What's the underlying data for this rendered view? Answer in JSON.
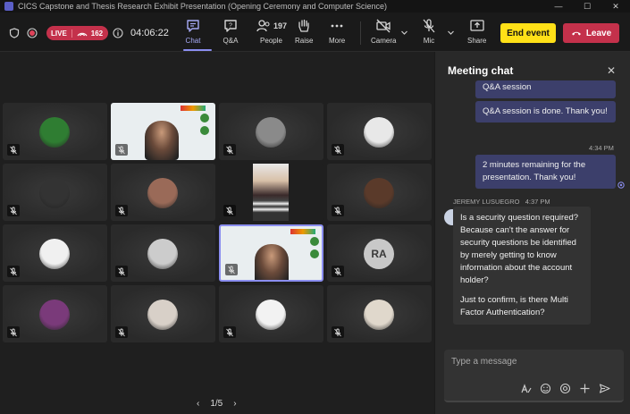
{
  "window": {
    "title": "CICS Capstone and Thesis Research Exhibit Presentation (Opening Ceremony and Computer Science)",
    "controls": [
      "—",
      "☐",
      "✕"
    ]
  },
  "toolbar": {
    "live_label": "LIVE",
    "viewers": "162",
    "timer": "04:06:22",
    "chat_label": "Chat",
    "qa_label": "Q&A",
    "people_label": "People",
    "people_count": "197",
    "raise_label": "Raise",
    "more_label": "More",
    "camera_label": "Camera",
    "mic_label": "Mic",
    "share_label": "Share",
    "end_event_label": "End event",
    "leave_label": "Leave"
  },
  "stage": {
    "tiles": [
      {
        "kind": "avatar",
        "color": "#2f7d32"
      },
      {
        "kind": "slide"
      },
      {
        "kind": "avatar",
        "color": "#8a8a8a"
      },
      {
        "kind": "avatar",
        "color": "#e8e8e8"
      },
      {
        "kind": "avatar",
        "color": "#333333"
      },
      {
        "kind": "avatar",
        "color": "#9a6a58"
      },
      {
        "kind": "portrait"
      },
      {
        "kind": "avatar",
        "color": "#5a3a2a"
      },
      {
        "kind": "avatar",
        "color": "#f0f0f0"
      },
      {
        "kind": "avatar",
        "color": "#cccccc"
      },
      {
        "kind": "slide-active"
      },
      {
        "kind": "initials",
        "initials": "RA"
      },
      {
        "kind": "avatar",
        "color": "#7a3a7a"
      },
      {
        "kind": "avatar",
        "color": "#d8d0c8"
      },
      {
        "kind": "avatar",
        "color": "#f2f2f2"
      },
      {
        "kind": "avatar",
        "color": "#e0d8cc"
      }
    ],
    "pager": {
      "label": "1/5",
      "prev": "‹",
      "next": "›"
    }
  },
  "chat": {
    "title": "Meeting chat",
    "messages_me": [
      {
        "text": "Q&A session"
      },
      {
        "text": "Q&A session is done. Thank you!"
      },
      {
        "text": "2 minutes remaining for the presentation. Thank you!",
        "time": "4:34 PM"
      }
    ],
    "sender": "JEREMY LUSUEGRO",
    "sender_time": "4:37 PM",
    "their_msg_p1": "Is a security question required? Because can't the answer for security questions be identified by merely getting to know information about the account holder?",
    "their_msg_p2": "Just to confirm, is there Multi Factor Authentication?",
    "composer_placeholder": "Type a message"
  },
  "colors": {
    "accent": "#8b8ef0",
    "live": "#c4314b",
    "end_event": "#ffe017"
  }
}
